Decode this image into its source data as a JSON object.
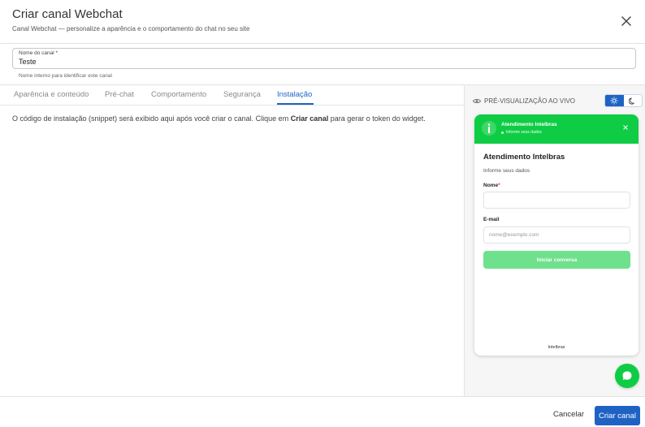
{
  "dialog": {
    "title": "Criar canal Webchat",
    "subtitle": "Canal Webchat — personalize a aparência e o comportamento do chat no seu site",
    "close_icon": "close-icon"
  },
  "channel_name": {
    "label": "Nome do canal *",
    "value": "Teste",
    "help": "Nome interno para identificar este canal"
  },
  "tabs": [
    {
      "label": "Aparência e conteúdo",
      "active": false
    },
    {
      "label": "Pré-chat",
      "active": false
    },
    {
      "label": "Comportamento",
      "active": false
    },
    {
      "label": "Segurança",
      "active": false
    },
    {
      "label": "Instalação",
      "active": true
    }
  ],
  "installation": {
    "text_before": "O código de instalação (snippet) será exibido aqui após você criar o canal. Clique em ",
    "text_bold": "Criar canal",
    "text_after": " para gerar o token do widget."
  },
  "preview": {
    "label": "PRÉ-VISUALIZAÇÃO AO VIVO",
    "eye_icon": "eye-icon",
    "theme": {
      "selected": "light",
      "light_icon": "sun-icon",
      "dark_icon": "moon-icon"
    },
    "widget": {
      "header_title": "Atendimento Intelbras",
      "header_status": "Informe seus dados",
      "title": "Atendimento Intelbras",
      "subtitle": "Informe seus dados",
      "name_label": "Nome",
      "name_required": "*",
      "name_value": "",
      "email_label": "E-mail",
      "email_placeholder": "nome@exemplo.com",
      "start_button": "Iniciar conversa",
      "footer": "Intelbras",
      "accent_color": "#0fcc45"
    }
  },
  "footer": {
    "cancel_label": "Cancelar",
    "create_label": "Criar canal"
  },
  "colors": {
    "primary": "#1e63c4",
    "widget_green": "#0fcc45",
    "widget_button_disabled": "#6fe08c"
  }
}
